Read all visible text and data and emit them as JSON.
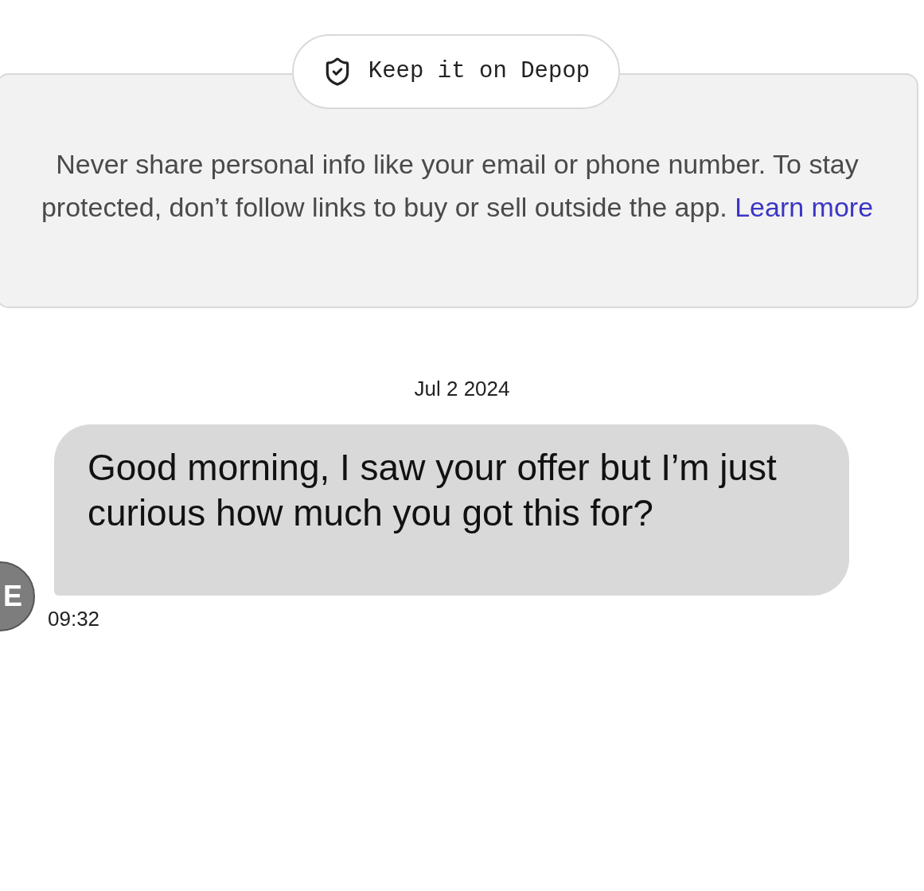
{
  "safety_notice": {
    "badge": "Keep it on Depop",
    "text": "Never share personal info like your email or phone number. To stay protected, don’t follow links to buy or sell outside the app.",
    "link": "Learn more"
  },
  "date_separator": "Jul 2 2024",
  "messages": [
    {
      "sender_initial": "E",
      "text": "Good morning, I saw your offer but I’m just curious how much you got this for?",
      "time": "09:32"
    }
  ]
}
